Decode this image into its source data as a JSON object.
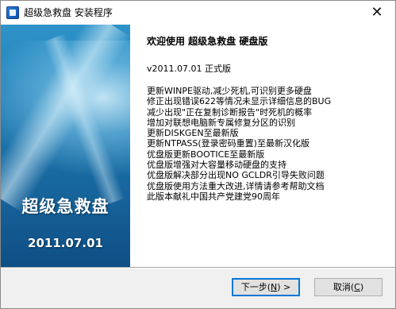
{
  "window": {
    "title": "超级急救盘 安装程序",
    "close_glyph": "✕"
  },
  "banner": {
    "title": "超级急救盘",
    "date": "2011.07.01"
  },
  "content": {
    "heading": "欢迎使用 超级急救盘 硬盘版",
    "version": "v2011.07.01 正式版",
    "changes": [
      "更新WINPE驱动,减少死机,可识别更多硬盘",
      "修正出现错误622等情况未显示详细信息的BUG",
      "减少出现\"正在复制诊断报告\"时死机的概率",
      "增加对联想电脑新专属修复分区的识别",
      "更新DISKGEN至最新版",
      "更新NTPASS(登录密码重置)至最新汉化版",
      "优盘版更新BOOTICE至最新版",
      "优盘版增强对大容量移动硬盘的支持",
      "优盘版解决部分出现NO GCLDR引导失败问题",
      "优盘版使用方法重大改进,详情请参考帮助文档",
      "此版本献礼中国共产党建党90周年"
    ]
  },
  "buttons": {
    "next_prefix": "下一步(",
    "next_mnemonic": "N",
    "next_suffix": ") >",
    "cancel_prefix": "取消(",
    "cancel_mnemonic": "C",
    "cancel_suffix": ")"
  },
  "icons": {
    "app": "installer-app-icon",
    "close": "close-icon"
  },
  "colors": {
    "banner_top": "#2e93c9",
    "banner_bottom": "#0f4f85",
    "focus_border": "#0078d7"
  }
}
